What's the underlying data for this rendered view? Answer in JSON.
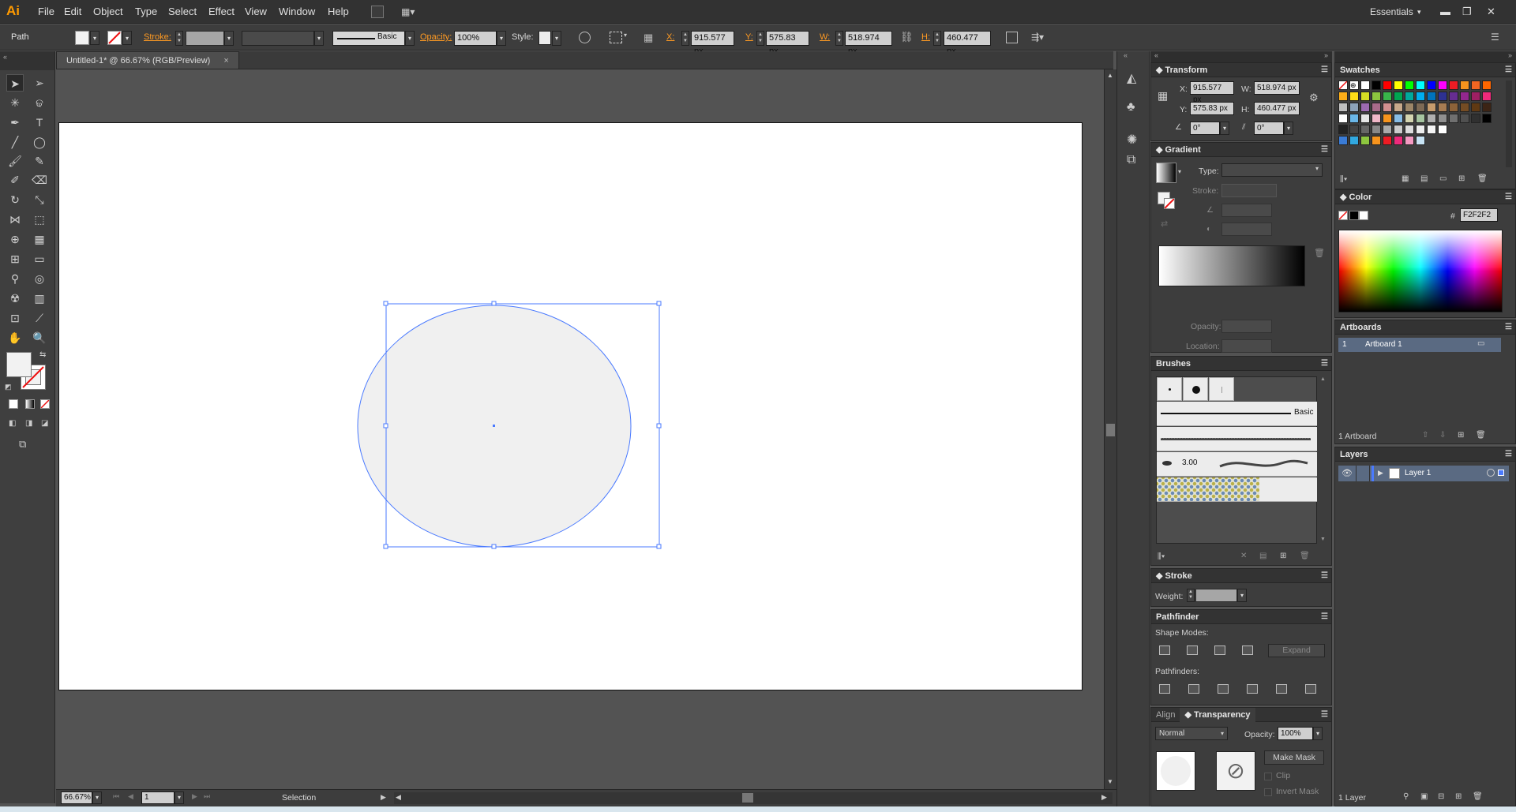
{
  "app": {
    "logo": "Ai",
    "workspace": "Essentials"
  },
  "menu": [
    "File",
    "Edit",
    "Object",
    "Type",
    "Select",
    "Effect",
    "View",
    "Window",
    "Help"
  ],
  "control": {
    "selection_type": "Path",
    "stroke_label": "Stroke:",
    "brush_label": "Basic",
    "opacity_label": "Opacity:",
    "opacity_value": "100%",
    "style_label": "Style:",
    "x_label": "X:",
    "x_value": "915.577 px",
    "y_label": "Y:",
    "y_value": "575.83 px",
    "w_label": "W:",
    "w_value": "518.974 px",
    "h_label": "H:",
    "h_value": "460.477 px"
  },
  "document": {
    "tab_title": "Untitled-1* @ 66.67% (RGB/Preview)"
  },
  "status": {
    "zoom": "66.67%",
    "artboard_num": "1",
    "tool": "Selection"
  },
  "transform": {
    "title": "Transform",
    "x_label": "X:",
    "x": "915.577 px",
    "y_label": "Y:",
    "y": "575.83 px",
    "w_label": "W:",
    "w": "518.974 px",
    "h_label": "H:",
    "h": "460.477 px",
    "rotate": "0°",
    "shear": "0°"
  },
  "gradient": {
    "title": "Gradient",
    "type_label": "Type:",
    "stroke_label": "Stroke:",
    "opacity_label": "Opacity:",
    "location_label": "Location:"
  },
  "brushes": {
    "title": "Brushes",
    "basic": "Basic",
    "size": "3.00"
  },
  "stroke": {
    "title": "Stroke",
    "weight_label": "Weight:"
  },
  "pathfinder": {
    "title": "Pathfinder",
    "shape_modes": "Shape Modes:",
    "pathfinders": "Pathfinders:",
    "expand": "Expand"
  },
  "transparency": {
    "tab_align": "Align",
    "title": "Transparency",
    "mode": "Normal",
    "opacity_label": "Opacity:",
    "opacity": "100%",
    "make_mask": "Make Mask",
    "clip": "Clip",
    "invert_mask": "Invert Mask"
  },
  "swatches": {
    "title": "Swatches"
  },
  "color": {
    "title": "Color",
    "hash": "#",
    "hex": "F2F2F2"
  },
  "artboards": {
    "title": "Artboards",
    "row_num": "1",
    "row_name": "Artboard 1",
    "count": "1 Artboard"
  },
  "layers": {
    "title": "Layers",
    "layer_name": "Layer 1",
    "count": "1 Layer"
  },
  "colors": {
    "accent": "#ff9a22",
    "selection": "#4a7aff",
    "fill": "#f2f2f2"
  }
}
